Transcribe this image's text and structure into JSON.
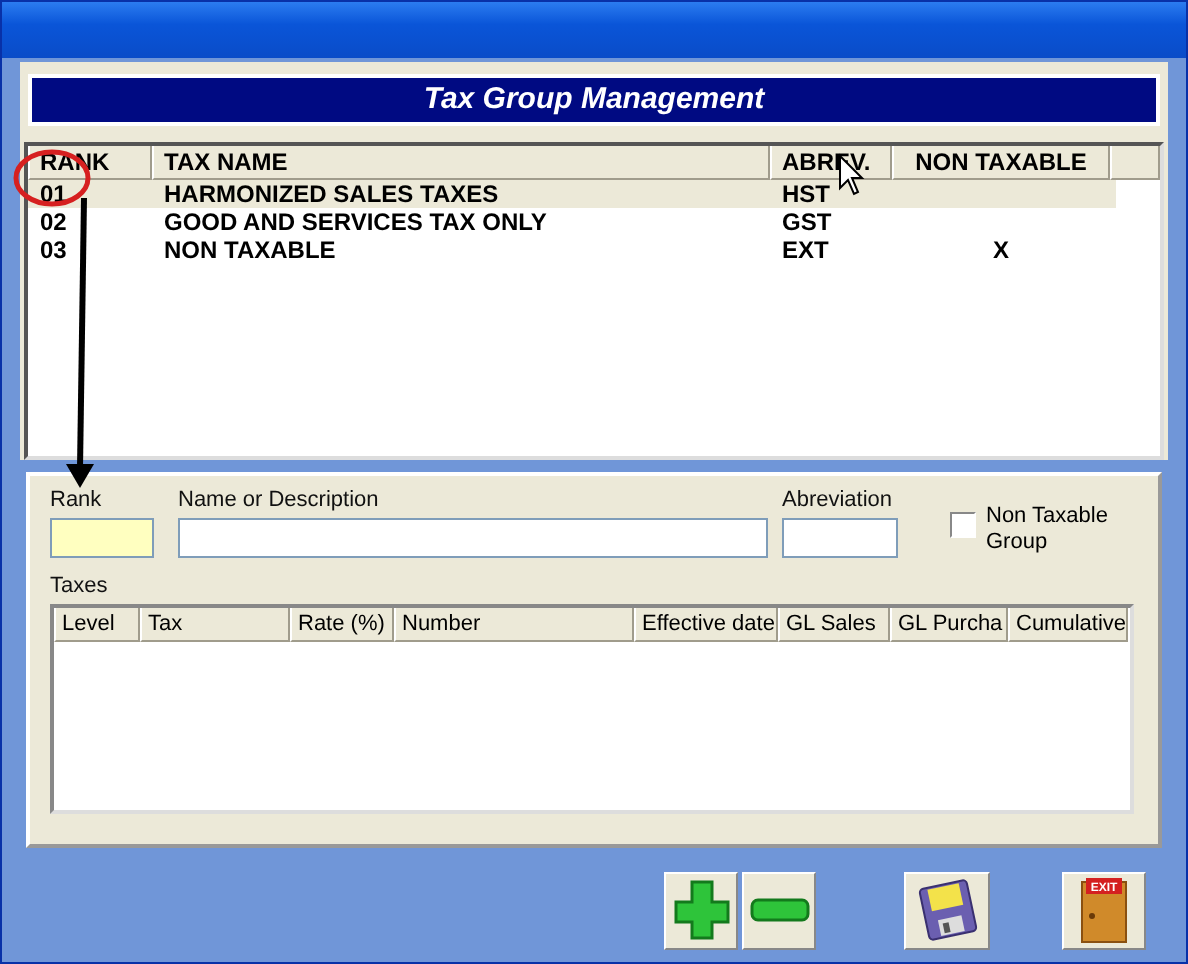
{
  "banner": {
    "title": "Tax Group Management"
  },
  "groups_table": {
    "columns": [
      "RANK",
      "TAX NAME",
      "ABREV.",
      "NON TAXABLE"
    ],
    "rows": [
      {
        "rank": "01",
        "tax_name": "HARMONIZED SALES TAXES",
        "abrev": "HST",
        "non_taxable": "",
        "selected": true
      },
      {
        "rank": "02",
        "tax_name": "GOOD AND SERVICES TAX ONLY",
        "abrev": "GST",
        "non_taxable": "",
        "selected": false
      },
      {
        "rank": "03",
        "tax_name": "NON TAXABLE",
        "abrev": "EXT",
        "non_taxable": "X",
        "selected": false
      }
    ]
  },
  "form": {
    "rank_label": "Rank",
    "name_label": "Name or Description",
    "abreviation_label": "Abreviation",
    "non_taxable": {
      "label": "Non Taxable Group",
      "checked": false
    },
    "taxes_label": "Taxes"
  },
  "taxes_table": {
    "columns": [
      "Level",
      "Tax",
      "Rate (%)",
      "Number",
      "Effective date",
      "GL Sales",
      "GL Purcha",
      "Cumulative"
    ]
  },
  "toolbar": {
    "exit_sign": "EXIT"
  }
}
